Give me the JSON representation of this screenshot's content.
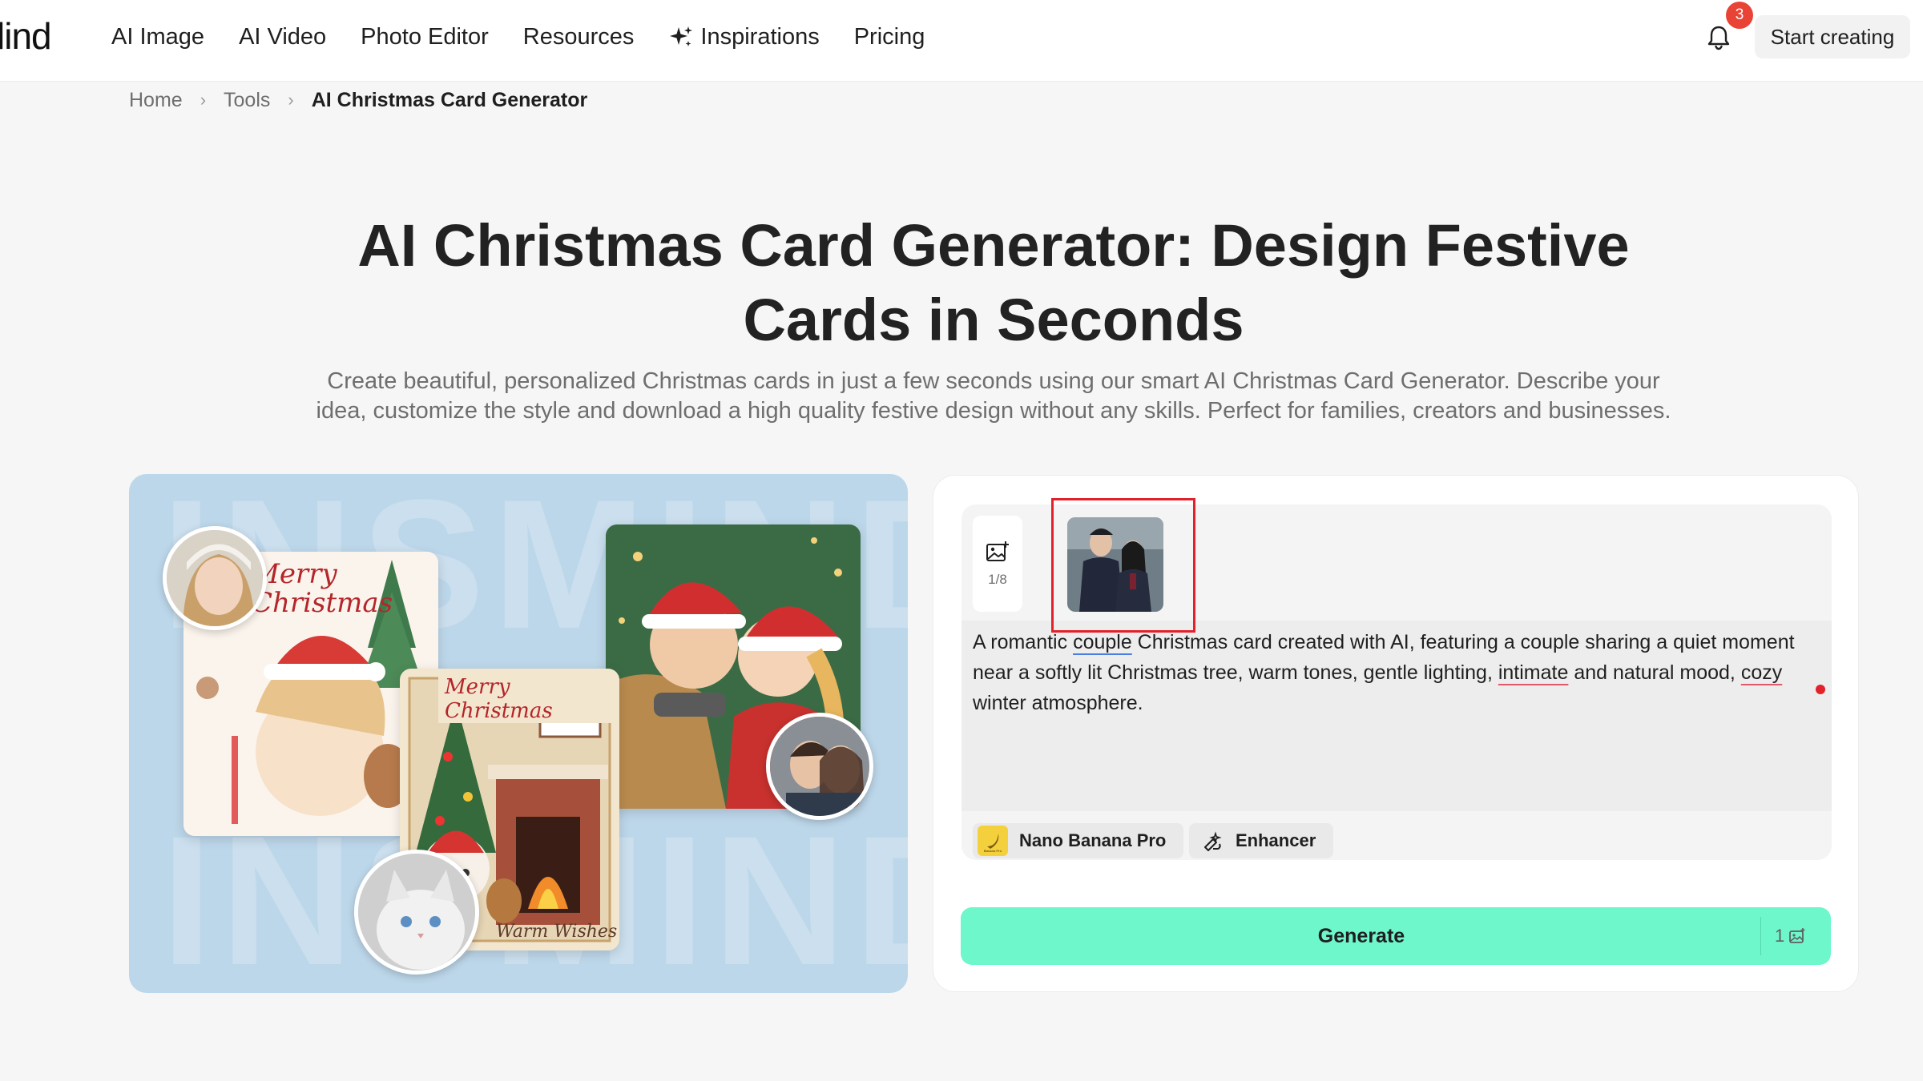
{
  "nav": {
    "logo_text": "lind",
    "items": [
      {
        "label": "AI Image"
      },
      {
        "label": "AI Video"
      },
      {
        "label": "Photo Editor"
      },
      {
        "label": "Resources"
      },
      {
        "label": "Inspirations",
        "icon": "sparkle-icon"
      },
      {
        "label": "Pricing"
      }
    ],
    "notification_count": "3",
    "start_button": "Start creating"
  },
  "breadcrumb": {
    "items": [
      "Home",
      "Tools"
    ],
    "current": "AI Christmas Card Generator"
  },
  "hero": {
    "title_line1": "AI Christmas Card Generator: Design Festive",
    "title_line2": "Cards in Seconds",
    "subtitle_line1": "Create beautiful, personalized Christmas cards in just a few seconds using our smart AI Christmas Card Generator. Describe your",
    "subtitle_line2": "idea, customize the style and download a high quality festive design without any skills. Perfect for families, creators and businesses."
  },
  "showcase": {
    "card_text_1": "Merry Christmas",
    "card_text_2": "Merry Christmas",
    "card_text_3": "Warm Wishes",
    "watermark": "INSMIND"
  },
  "editor": {
    "upload_count": "1/8",
    "prompt_parts": {
      "p1": "A romantic ",
      "w_couple": "couple",
      "p2": " Christmas card created with AI, featuring a couple sharing a quiet moment near a softly lit Christmas tree, warm tones, gentle lighting, ",
      "w_intimate": "intimate",
      "p3": " and natural mood, ",
      "w_cozy": "cozy",
      "p4": " winter atmosphere."
    },
    "model_chip": "Nano Banana Pro",
    "model_icon_caption": "Banana Pro",
    "enhancer_chip": "Enhancer",
    "generate_label": "Generate",
    "generate_cost": "1"
  },
  "colors": {
    "accent_generate": "#6ef7cb",
    "badge_red": "#e84335",
    "highlight_red": "#e3212b",
    "showcase_bg": "#bdd7ea"
  }
}
